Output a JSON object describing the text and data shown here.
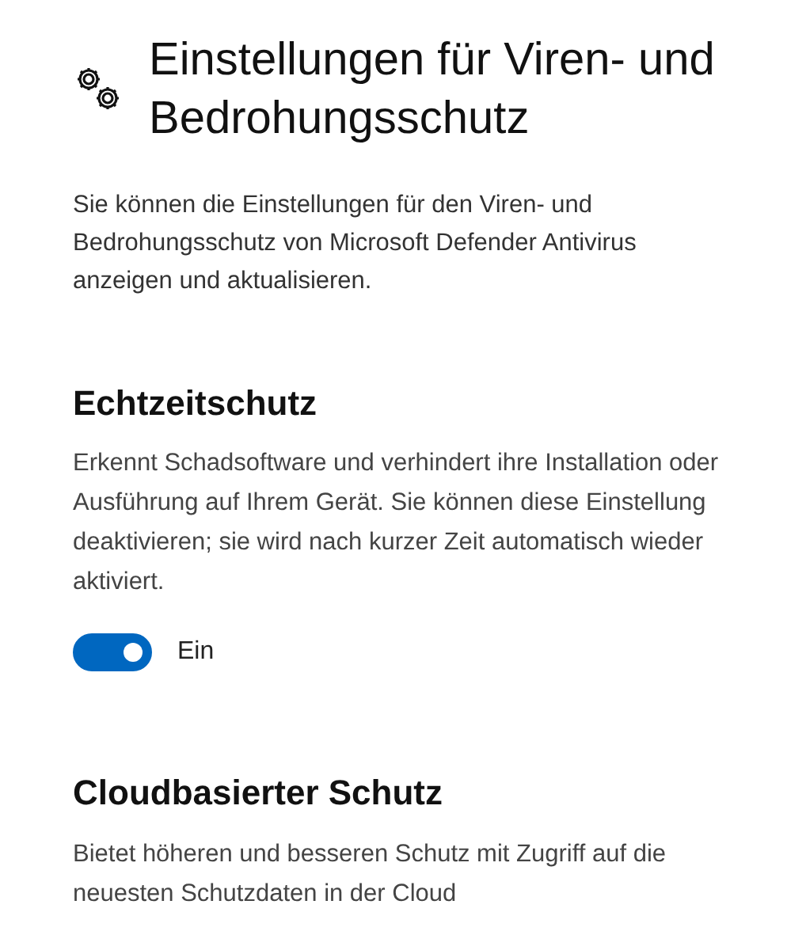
{
  "page": {
    "title": "Einstellungen für Viren- und Bedrohungsschutz",
    "description": "Sie können die Einstellungen für den Viren- und Bedrohungsschutz von Microsoft Defender Antivirus anzeigen und aktualisieren."
  },
  "sections": [
    {
      "heading": "Echtzeitschutz",
      "description": "Erkennt Schadsoftware und verhindert ihre Installation oder Ausführung auf Ihrem Gerät. Sie können diese Einstellung deaktivieren; sie wird nach kurzer Zeit automatisch wieder aktiviert.",
      "toggle": {
        "on": true,
        "label": "Ein"
      }
    },
    {
      "heading": "Cloudbasierter Schutz",
      "description": "Bietet höheren und besseren Schutz mit Zugriff auf die neuesten Schutzdaten in der Cloud"
    }
  ]
}
